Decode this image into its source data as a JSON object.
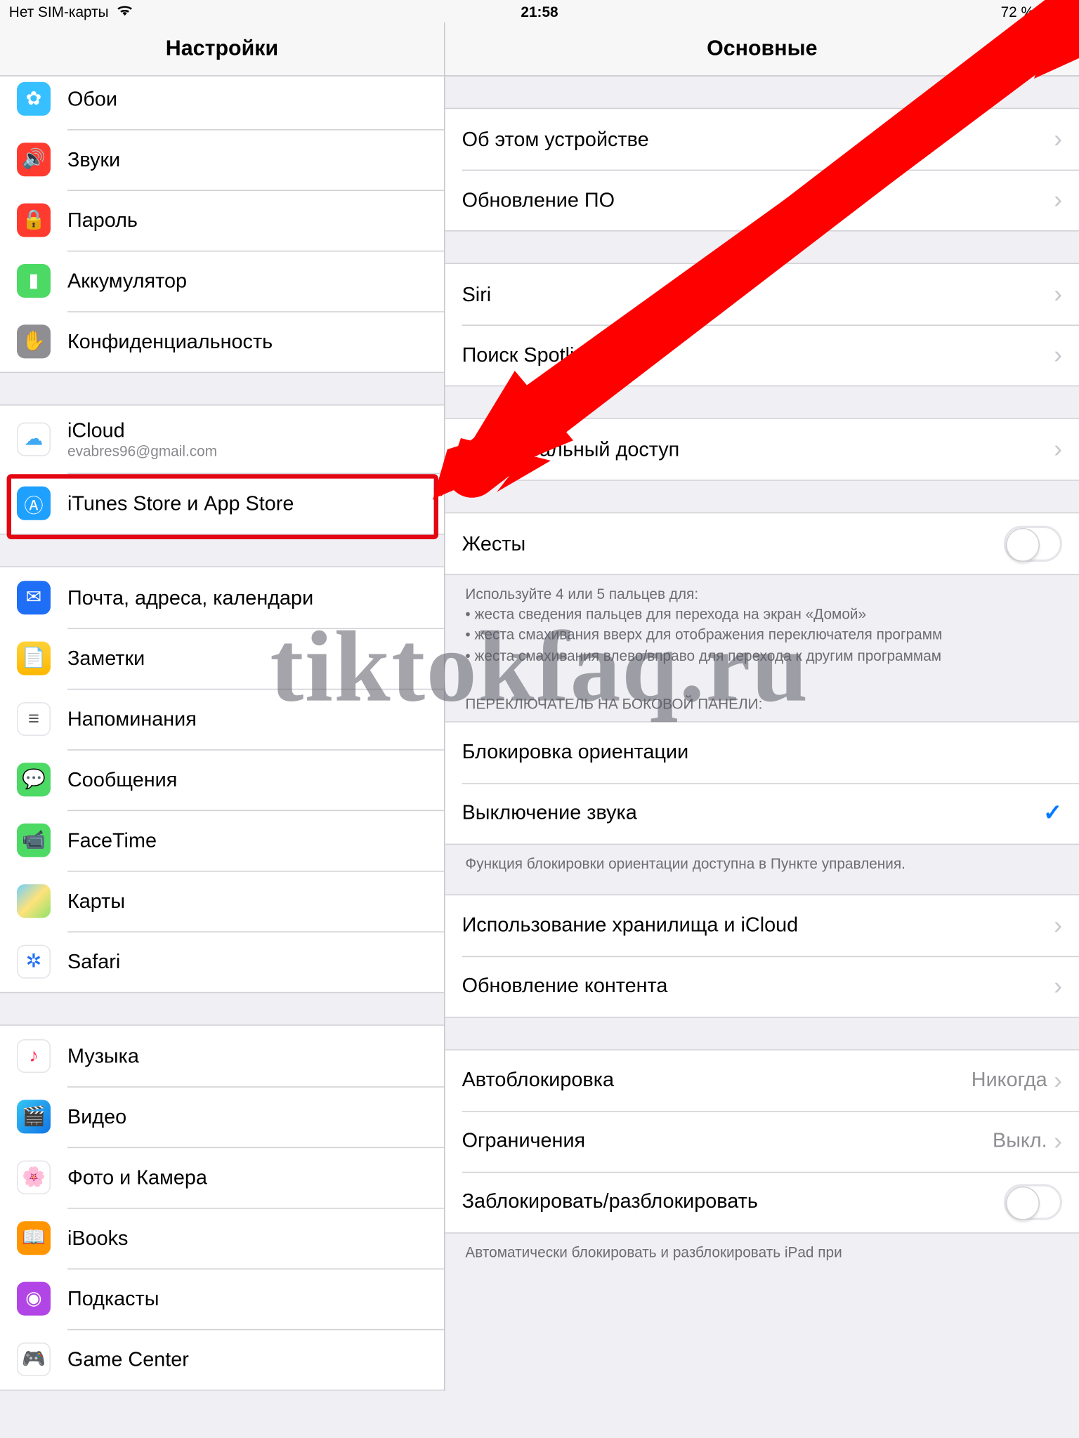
{
  "status": {
    "sim": "Нет SIM-карты",
    "time": "21:58",
    "battery": "72 %"
  },
  "left": {
    "title": "Настройки",
    "g1": [
      {
        "label": "Обои",
        "icon": "#2fb7ff"
      },
      {
        "label": "Звуки",
        "icon": "#ff3b30"
      },
      {
        "label": "Пароль",
        "icon": "#ff3b30"
      },
      {
        "label": "Аккумулятор",
        "icon": "#4cd964"
      },
      {
        "label": "Конфиденциальность",
        "icon": "#8e8e93"
      }
    ],
    "g2": [
      {
        "label": "iCloud",
        "sub": "evabres96@gmail.com",
        "icon": "#ffffff"
      },
      {
        "label": "iTunes Store и App Store",
        "icon": "#1ea0ff"
      }
    ],
    "g3": [
      {
        "label": "Почта, адреса, календари",
        "icon": "#1f6ef6"
      },
      {
        "label": "Заметки",
        "icon": "#ffd23a"
      },
      {
        "label": "Напоминания",
        "icon": "#ffffff"
      },
      {
        "label": "Сообщения",
        "icon": "#4cd964"
      },
      {
        "label": "FaceTime",
        "icon": "#4cd964"
      },
      {
        "label": "Карты",
        "icon": "#ffffff"
      },
      {
        "label": "Safari",
        "icon": "#ffffff"
      }
    ],
    "g4": [
      {
        "label": "Музыка",
        "icon": "#ffffff"
      },
      {
        "label": "Видео",
        "icon": "#ffffff"
      },
      {
        "label": "Фото и Камера",
        "icon": "#ffffff"
      },
      {
        "label": "iBooks",
        "icon": "#ff9500"
      },
      {
        "label": "Подкасты",
        "icon": "#b245e6"
      },
      {
        "label": "Game Center",
        "icon": "#ffffff"
      }
    ]
  },
  "right": {
    "title": "Основные",
    "g1": [
      {
        "label": "Об этом устройстве"
      },
      {
        "label": "Обновление ПО"
      }
    ],
    "g2": [
      {
        "label": "Siri"
      },
      {
        "label": "Поиск Spotlight"
      }
    ],
    "g3": [
      {
        "label": "Универсальный доступ"
      }
    ],
    "g4": [
      {
        "label": "Жесты"
      }
    ],
    "g4_footer": "Используйте 4 или 5 пальцев для:\n• жеста сведения пальцев для перехода на экран «Домой»\n• жеста смахивания вверх для отображения переключателя программ\n• жеста смахивания влево/вправо для перехода к другим программам",
    "g5_header": "ПЕРЕКЛЮЧАТЕЛЬ НА БОКОВОЙ ПАНЕЛИ:",
    "g5": [
      {
        "label": "Блокировка ориентации"
      },
      {
        "label": "Выключение звука",
        "checked": true
      }
    ],
    "g5_footer": "Функция блокировки ориентации доступна в Пункте управления.",
    "g6": [
      {
        "label": "Использование хранилища и iCloud"
      },
      {
        "label": "Обновление контента"
      }
    ],
    "g7": [
      {
        "label": "Автоблокировка",
        "value": "Никогда"
      },
      {
        "label": "Ограничения",
        "value": "Выкл."
      },
      {
        "label": "Заблокировать/разблокировать",
        "toggle": true
      }
    ],
    "g7_footer": "Автоматически блокировать и разблокировать iPad при"
  },
  "watermark": "tiktokfaq.ru"
}
